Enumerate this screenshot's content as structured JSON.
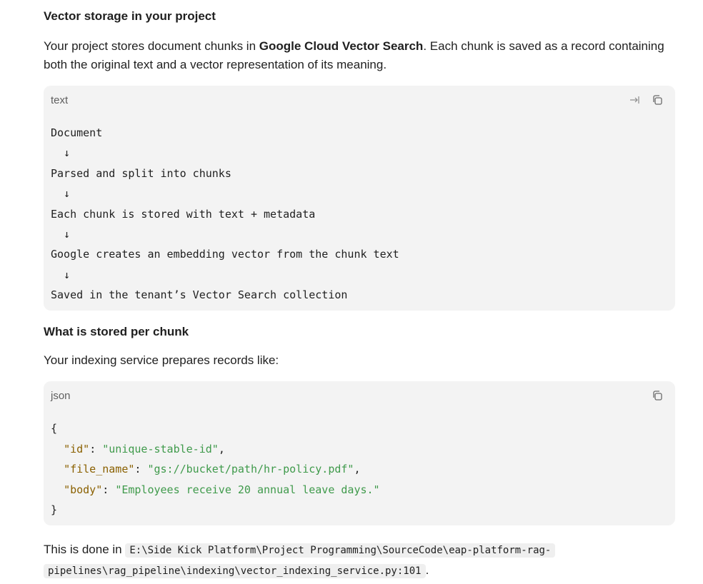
{
  "section1": {
    "heading": "Vector storage in your project",
    "intro_before": "Your project stores document chunks in ",
    "intro_bold": "Google Cloud Vector Search",
    "intro_after": ". Each chunk is saved as a record containing both the original text and a vector representation of its meaning."
  },
  "text_block": {
    "language": "text",
    "lines": [
      "Document",
      "  ↓",
      "Parsed and split into chunks",
      "  ↓",
      "Each chunk is stored with text + metadata",
      "  ↓",
      "Google creates an embedding vector from the chunk text",
      "  ↓",
      "Saved in the tenant’s Vector Search collection"
    ],
    "icons": [
      "wrap-icon",
      "copy-icon"
    ]
  },
  "section2": {
    "heading": "What is stored per chunk",
    "intro": "Your indexing service prepares records like:"
  },
  "json_block": {
    "language": "json",
    "open_brace": "{",
    "close_brace": "}",
    "fields": [
      {
        "key": "\"id\"",
        "value": "\"unique-stable-id\"",
        "trail": ","
      },
      {
        "key": "\"file_name\"",
        "value": "\"gs://bucket/path/hr-policy.pdf\"",
        "trail": ","
      },
      {
        "key": "\"body\"",
        "value": "\"Employees receive 20 annual leave days.\"",
        "trail": ""
      }
    ],
    "icons": [
      "copy-icon"
    ]
  },
  "footer": {
    "before": "This is done in ",
    "path_line1": "E:\\Side Kick Platform\\Project Programming\\SourceCode\\eap-platform-rag-",
    "path_line2": "pipelines\\rag_pipeline\\indexing\\vector_indexing_service.py:101",
    "after": "."
  },
  "colors": {
    "json_key": "#8a6000",
    "json_string": "#3f9a4b",
    "code_bg": "#f3f3f3"
  }
}
